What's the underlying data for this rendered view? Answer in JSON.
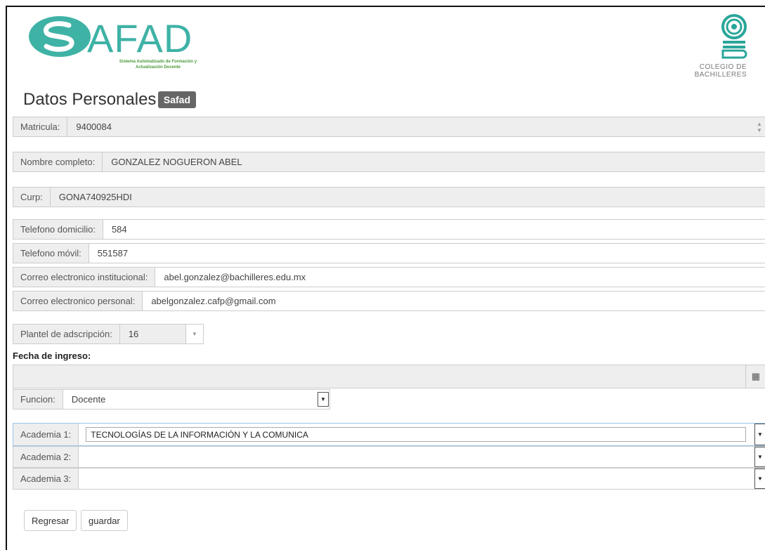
{
  "header": {
    "logo_word": "AFAD",
    "logo_subtitle_1": "Sistema Automatizado de Formación y",
    "logo_subtitle_2": "Actualización Docente",
    "cb_line1": "COLEGIO DE",
    "cb_line2": "BACHILLERES"
  },
  "page": {
    "title": "Datos Personales",
    "badge": "Safad"
  },
  "form": {
    "matricula": {
      "label": "Matricula:",
      "value": "9400084"
    },
    "nombre": {
      "label": "Nombre completo:",
      "value": "GONZALEZ NOGUERON ABEL"
    },
    "curp": {
      "label": "Curp:",
      "value": "GONA740925HDI"
    },
    "tel_dom": {
      "label": "Telefono domicilio:",
      "value": "584"
    },
    "tel_movil": {
      "label": "Telefono móvil:",
      "value": "551587"
    },
    "correo_inst": {
      "label": "Correo electronico institucional:",
      "value": "abel.gonzalez@bachilleres.edu.mx"
    },
    "correo_pers": {
      "label": "Correo electronico personal:",
      "value": "abelgonzalez.cafp@gmail.com"
    },
    "plantel": {
      "label": "Plantel de adscripción:",
      "value": "16"
    },
    "fecha_label": "Fecha de ingreso:",
    "funcion": {
      "label": "Funcion:",
      "value": "Docente"
    },
    "academia1": {
      "label": "Academia 1:",
      "value": "TECNOLOGÍAS DE LA INFORMACIÓN Y LA COMUNICA"
    },
    "academia2": {
      "label": "Academia 2:",
      "value": ""
    },
    "academia3": {
      "label": "Academia 3:",
      "value": ""
    }
  },
  "buttons": {
    "regresar": "Regresar",
    "guardar": "guardar"
  },
  "colors": {
    "teal": "#3fb2a6",
    "badge": "#666666"
  }
}
